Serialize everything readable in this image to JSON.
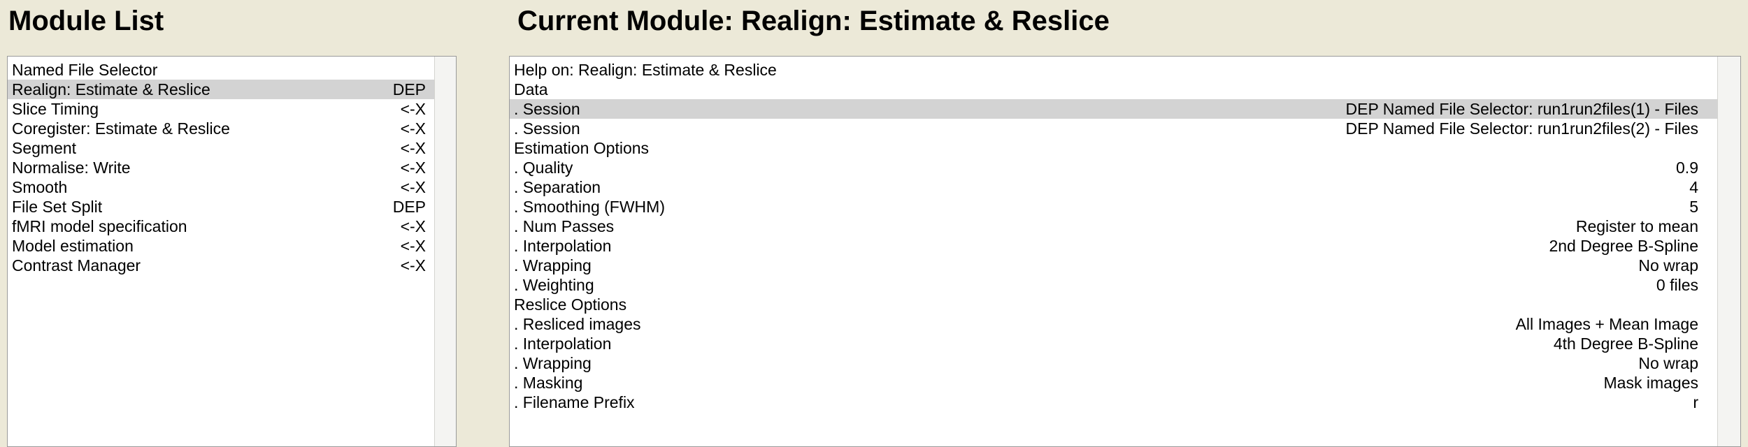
{
  "left_panel": {
    "title": "Module List",
    "items": [
      {
        "label": "Named File Selector",
        "status": "",
        "selected": false
      },
      {
        "label": "Realign: Estimate & Reslice",
        "status": "DEP",
        "selected": true
      },
      {
        "label": "Slice Timing",
        "status": "<-X",
        "selected": false
      },
      {
        "label": "Coregister: Estimate & Reslice",
        "status": "<-X",
        "selected": false
      },
      {
        "label": "Segment",
        "status": "<-X",
        "selected": false
      },
      {
        "label": "Normalise: Write",
        "status": "<-X",
        "selected": false
      },
      {
        "label": "Smooth",
        "status": "<-X",
        "selected": false
      },
      {
        "label": "File Set Split",
        "status": "DEP",
        "selected": false
      },
      {
        "label": "fMRI model specification",
        "status": "<-X",
        "selected": false
      },
      {
        "label": "Model estimation",
        "status": "<-X",
        "selected": false
      },
      {
        "label": "Contrast Manager",
        "status": "<-X",
        "selected": false
      }
    ]
  },
  "right_panel": {
    "title": "Current Module: Realign: Estimate & Reslice",
    "items": [
      {
        "label": "Help on: Realign: Estimate & Reslice",
        "value": "",
        "selected": false
      },
      {
        "label": "Data",
        "value": "",
        "selected": false
      },
      {
        "label": ". Session",
        "value": "DEP Named File Selector: run1run2files(1) - Files",
        "selected": true
      },
      {
        "label": ". Session",
        "value": "DEP Named File Selector: run1run2files(2) - Files",
        "selected": false
      },
      {
        "label": "Estimation Options",
        "value": "",
        "selected": false
      },
      {
        "label": ". Quality",
        "value": "0.9",
        "selected": false
      },
      {
        "label": ". Separation",
        "value": "4",
        "selected": false
      },
      {
        "label": ". Smoothing (FWHM)",
        "value": "5",
        "selected": false
      },
      {
        "label": ". Num Passes",
        "value": "Register to mean",
        "selected": false
      },
      {
        "label": ". Interpolation",
        "value": "2nd Degree B-Spline",
        "selected": false
      },
      {
        "label": ". Wrapping",
        "value": "No wrap",
        "selected": false
      },
      {
        "label": ". Weighting",
        "value": "0 files",
        "selected": false
      },
      {
        "label": "Reslice Options",
        "value": "",
        "selected": false
      },
      {
        "label": ". Resliced images",
        "value": "All Images + Mean Image",
        "selected": false
      },
      {
        "label": ". Interpolation",
        "value": "4th Degree B-Spline",
        "selected": false
      },
      {
        "label": ". Wrapping",
        "value": "No wrap",
        "selected": false
      },
      {
        "label": ". Masking",
        "value": "Mask images",
        "selected": false
      },
      {
        "label": ". Filename Prefix",
        "value": "r",
        "selected": false
      }
    ]
  }
}
